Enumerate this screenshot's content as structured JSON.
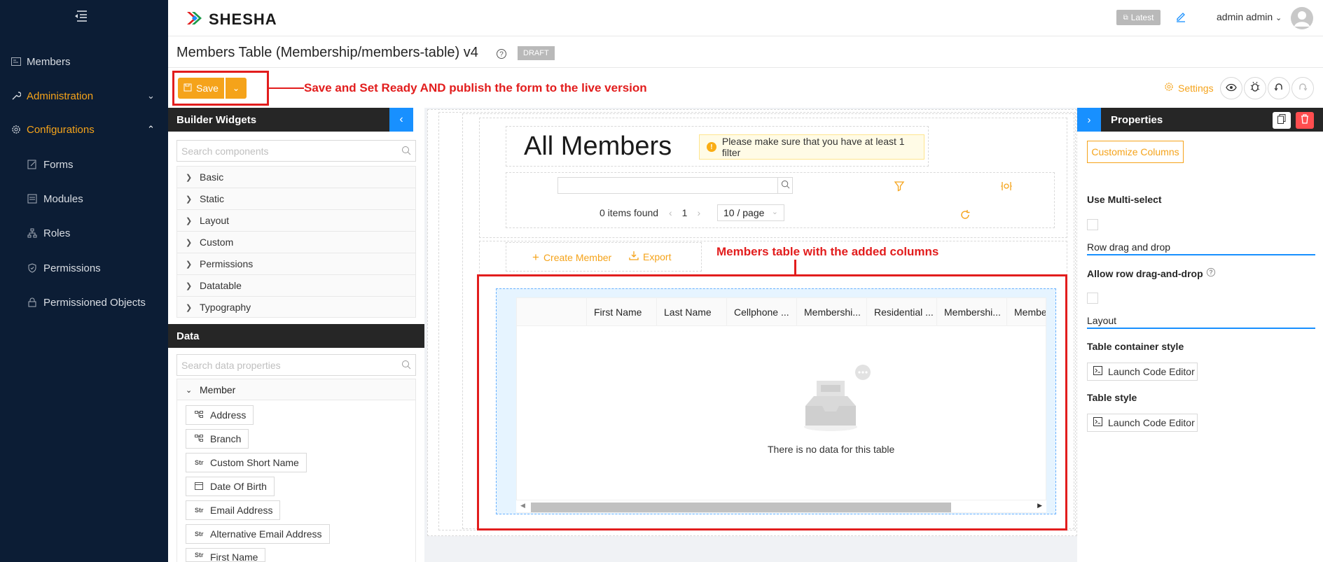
{
  "sidebar": {
    "items": [
      {
        "label": "Members",
        "icon": "id-card-icon"
      },
      {
        "label": "Administration",
        "icon": "wrench-icon"
      },
      {
        "label": "Configurations",
        "icon": "gear-icon"
      },
      {
        "label": "Forms",
        "icon": "form-icon"
      },
      {
        "label": "Modules",
        "icon": "modules-icon"
      },
      {
        "label": "Roles",
        "icon": "roles-icon"
      },
      {
        "label": "Permissions",
        "icon": "shield-icon"
      },
      {
        "label": "Permissioned Objects",
        "icon": "lock-icon"
      }
    ]
  },
  "header": {
    "logo_text": "SHESHA",
    "latest_label": "Latest",
    "user_name": "admin admin"
  },
  "titlebar": {
    "title": "Members Table (Membership/members-table) v4",
    "status_badge": "DRAFT"
  },
  "toolbar": {
    "save_label": "Save",
    "settings_label": "Settings"
  },
  "annotations": {
    "save_note": "Save and Set Ready AND publish the form to the live version",
    "table_note": "Members table with the added columns"
  },
  "builder_widgets": {
    "title": "Builder Widgets",
    "search_placeholder": "Search components",
    "groups": [
      "Basic",
      "Static",
      "Layout",
      "Custom",
      "Permissions",
      "Datatable",
      "Typography"
    ]
  },
  "data_panel": {
    "title": "Data",
    "search_placeholder": "Search data properties",
    "group": "Member",
    "properties": [
      {
        "label": "Address",
        "type": "object"
      },
      {
        "label": "Branch",
        "type": "object"
      },
      {
        "label": "Custom Short Name",
        "type": "Str"
      },
      {
        "label": "Date Of Birth",
        "type": "date"
      },
      {
        "label": "Email Address",
        "type": "Str"
      },
      {
        "label": "Alternative Email Address",
        "type": "Str"
      },
      {
        "label": "First Name",
        "type": "Str"
      }
    ]
  },
  "canvas": {
    "heading": "All Members",
    "filter_warning": "Please make sure that you have at least 1 filter",
    "items_found": "0 items found",
    "current_page": "1",
    "page_size": "10 / page",
    "create_label": "Create Member",
    "export_label": "Export",
    "columns": [
      "First Name",
      "Last Name",
      "Cellphone ...",
      "Membershi...",
      "Residential ...",
      "Membershi...",
      "Membe"
    ],
    "empty_text": "There is no data for this table"
  },
  "properties_panel": {
    "title": "Properties",
    "customize_columns_label": "Customize Columns",
    "use_multiselect_label": "Use Multi-select",
    "row_drag_section": "Row drag and drop",
    "allow_row_drag_label": "Allow row drag-and-drop",
    "layout_section": "Layout",
    "table_container_style_label": "Table container style",
    "table_style_label": "Table style",
    "launch_code_editor_label": "Launch Code Editor"
  },
  "colors": {
    "accent": "#f5a31a",
    "sidebar_bg": "#0c1d35",
    "annotation_red": "#e21d1d",
    "primary_blue": "#1890ff"
  }
}
